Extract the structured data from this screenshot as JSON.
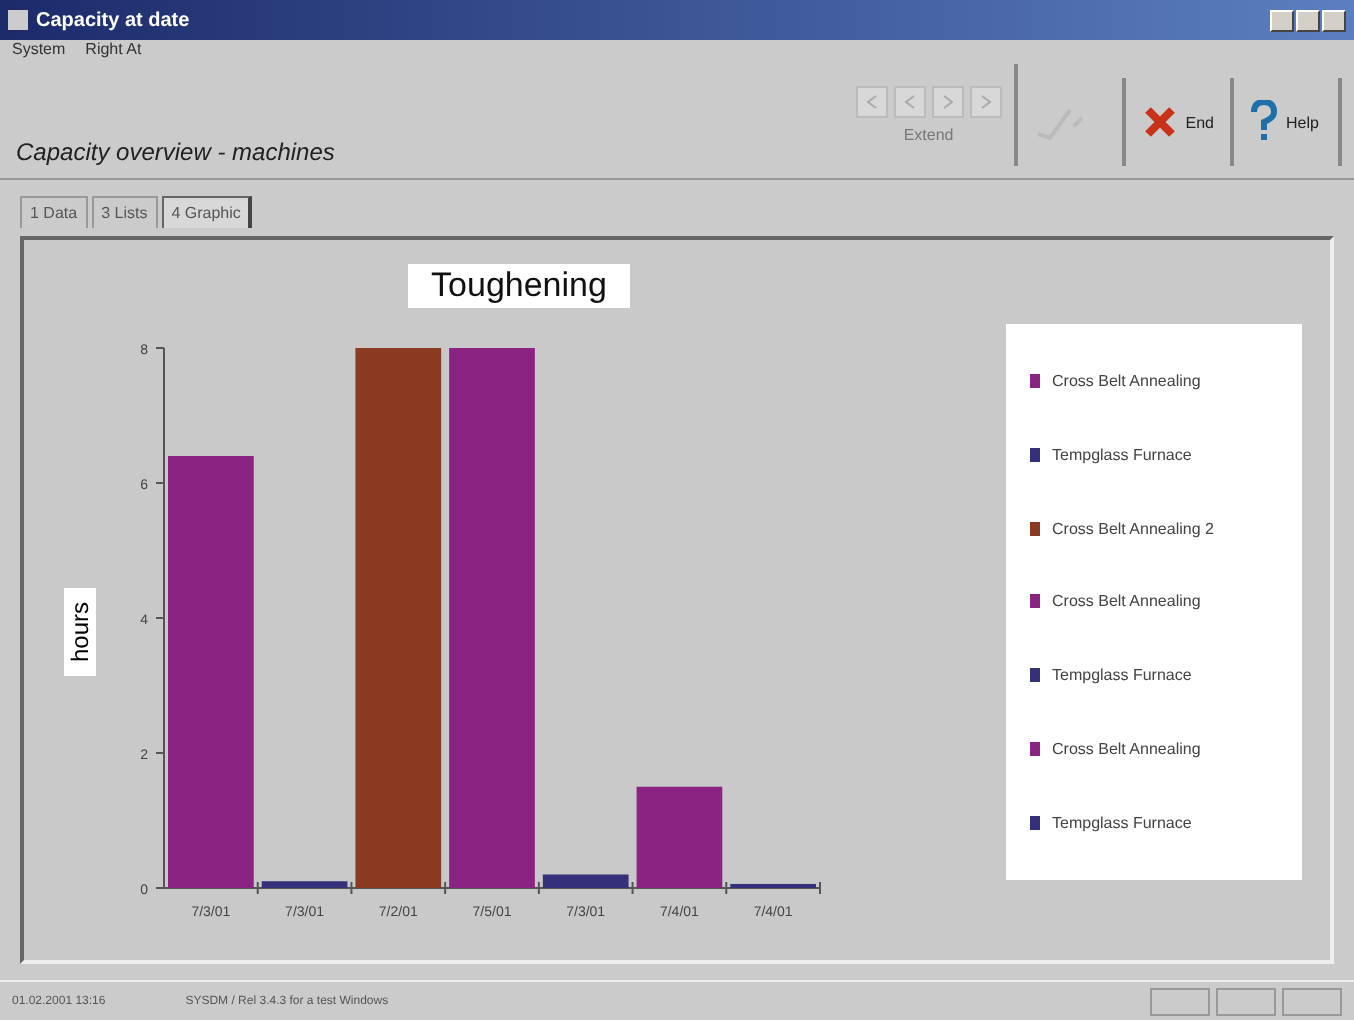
{
  "window": {
    "title": "Capacity at date"
  },
  "menu": [
    "System",
    "Right At"
  ],
  "toolbar": {
    "heading": "Capacity overview - machines",
    "nav_label": "Extend",
    "buttons": [
      {
        "kind": "confirm",
        "disabled": true
      },
      {
        "kind": "end",
        "label": "End",
        "disabled": false
      },
      {
        "kind": "help",
        "label": "Help",
        "disabled": false
      }
    ]
  },
  "tabs": [
    {
      "label": "1 Data",
      "selected": false
    },
    {
      "label": "3 Lists",
      "selected": false
    },
    {
      "label": "4 Graphic",
      "selected": true
    }
  ],
  "chart": {
    "chart_data": {
      "type": "bar",
      "title": "Toughening",
      "ylabel": "hours",
      "categories": [
        "7/3/01",
        "7/3/01",
        "7/2/01",
        "7/5/01",
        "7/3/01",
        "7/4/01",
        "7/4/01"
      ],
      "stacked": true,
      "ylim": [
        0,
        8
      ],
      "yticks": [
        0,
        2,
        4,
        6,
        8
      ],
      "series": [
        {
          "name": "Cross Belt Annealing",
          "color": "#8b2382",
          "values": [
            6.4,
            null,
            null,
            null,
            null,
            null,
            null
          ]
        },
        {
          "name": "Tempglass Furnace",
          "color": "#35307a",
          "values": [
            null,
            0.1,
            null,
            null,
            null,
            null,
            null
          ]
        },
        {
          "name": "Cross Belt Annealing 2",
          "color": "#8b3a22",
          "values": [
            null,
            null,
            8,
            null,
            null,
            null,
            null
          ]
        },
        {
          "name": "Cross Belt Annealing",
          "color": "#8b2382",
          "values": [
            null,
            null,
            null,
            8,
            null,
            null,
            null
          ]
        },
        {
          "name": "Tempglass Furnace",
          "color": "#35307a",
          "values": [
            null,
            null,
            null,
            null,
            0.2,
            null,
            null
          ]
        },
        {
          "name": "Cross Belt Annealing",
          "color": "#8b2382",
          "values": [
            null,
            null,
            null,
            null,
            null,
            1.5,
            null
          ]
        },
        {
          "name": "Tempglass Furnace",
          "color": "#35307a",
          "values": [
            null,
            null,
            null,
            null,
            null,
            null,
            0.06
          ]
        }
      ]
    }
  },
  "status_bar": [
    "01.02.2001 13:16",
    "SYSDM / Rel 3.4.3 for a test Windows"
  ]
}
